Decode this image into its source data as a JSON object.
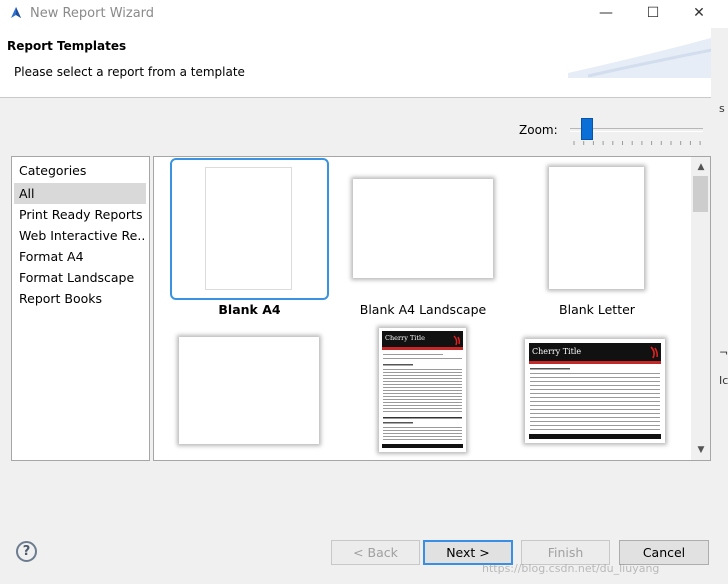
{
  "window": {
    "title": "New Report Wizard",
    "minimize_glyph": "—",
    "maximize_glyph": "☐",
    "close_glyph": "✕"
  },
  "header": {
    "heading": "Report Templates",
    "description": "Please select a report from a template"
  },
  "zoom": {
    "label": "Zoom:",
    "level": 0.15
  },
  "categories": {
    "title": "Categories",
    "items": [
      {
        "label": "All",
        "selected": true
      },
      {
        "label": "Print Ready Reports",
        "selected": false
      },
      {
        "label": "Web Interactive Re...",
        "selected": false
      },
      {
        "label": "Format A4",
        "selected": false
      },
      {
        "label": "Format Landscape",
        "selected": false
      },
      {
        "label": "Report Books",
        "selected": false
      }
    ]
  },
  "templates": [
    {
      "label": "Blank A4",
      "selected": true
    },
    {
      "label": "Blank A4 Landscape",
      "selected": false
    },
    {
      "label": "Blank Letter",
      "selected": false
    },
    {
      "label": "",
      "selected": false
    },
    {
      "label": "",
      "selected": false,
      "preview_title": "Cherry Title"
    },
    {
      "label": "",
      "selected": false,
      "preview_title": "Cherry Title"
    }
  ],
  "footer": {
    "help_glyph": "?",
    "back_label": "< Back",
    "next_label": "Next >",
    "finish_label": "Finish",
    "cancel_label": "Cancel"
  },
  "watermark": "https://blog.csdn.net/du_liuyang",
  "side_fragments": [
    "s",
    "¬",
    "Ic"
  ],
  "colors": {
    "accent": "#3a93e0",
    "zoom_thumb": "#0a6fd6"
  }
}
